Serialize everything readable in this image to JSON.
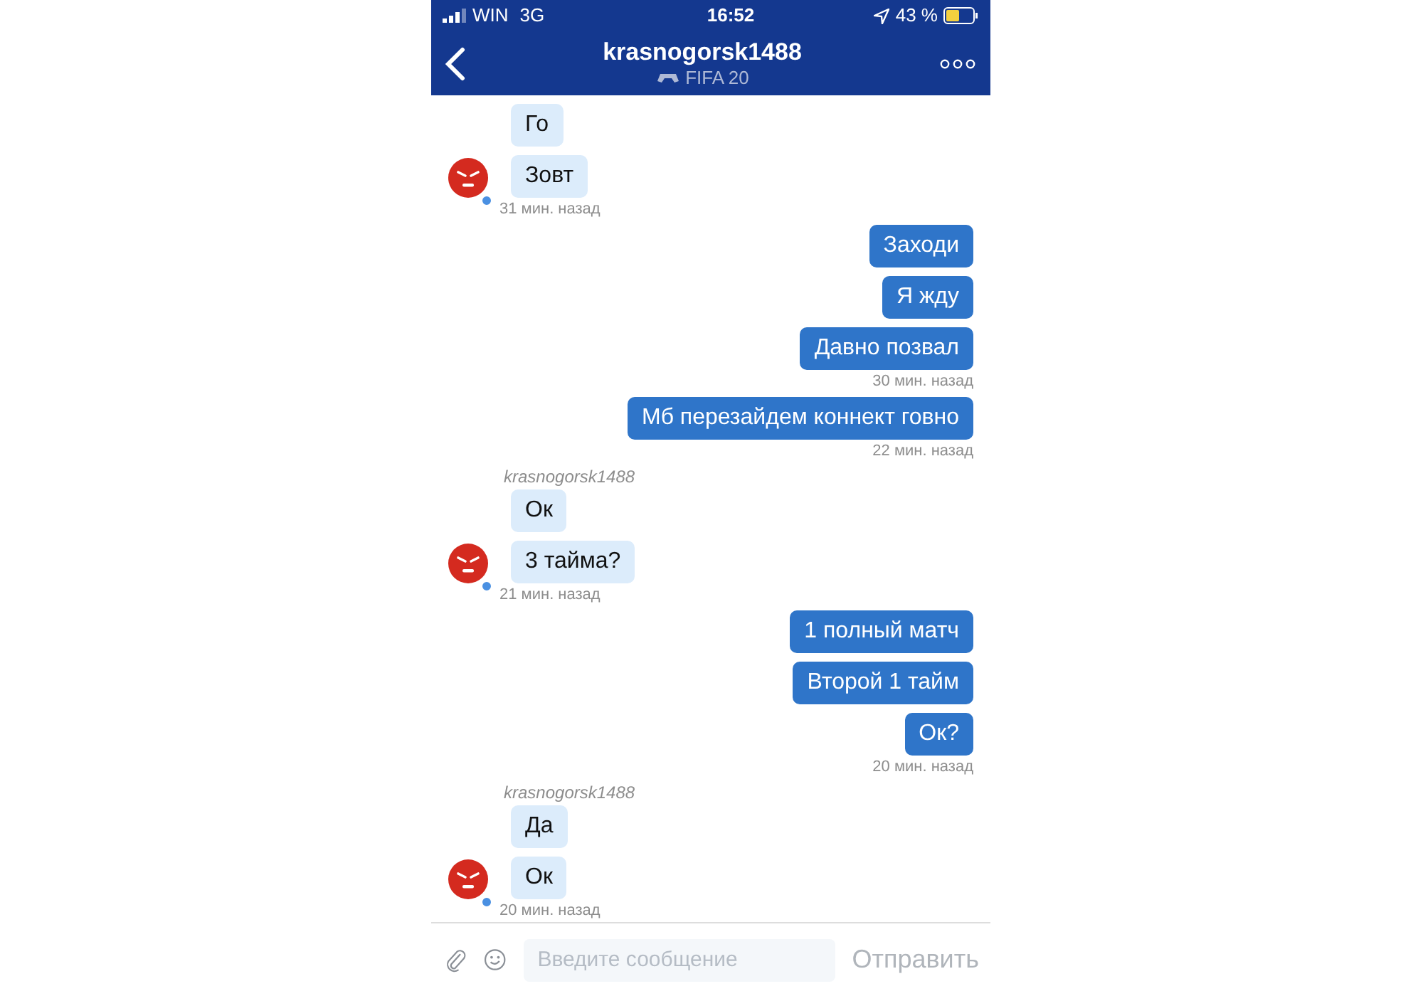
{
  "status_bar": {
    "carrier": "WIN",
    "network": "3G",
    "time": "16:52",
    "battery": "43 %"
  },
  "header": {
    "title": "krasnogorsk1488",
    "subtitle": "FIFA 20"
  },
  "messages": [
    {
      "kind": "incoming",
      "online": true,
      "bubbles": [
        "Го",
        "Зовт"
      ],
      "time": "31 мин. назад"
    },
    {
      "kind": "outgoing",
      "bubbles": [
        "Заходи",
        "Я жду",
        "Давно позвал"
      ],
      "time": "30 мин. назад"
    },
    {
      "kind": "outgoing",
      "bubbles": [
        "Мб перезайдем коннект говно"
      ],
      "time": "22 мин. назад"
    },
    {
      "kind": "incoming",
      "online": true,
      "author": "krasnogorsk1488",
      "bubbles": [
        "Ок",
        "3 тайма?"
      ],
      "time": "21 мин. назад"
    },
    {
      "kind": "outgoing",
      "bubbles": [
        "1 полный матч",
        "Второй 1 тайм",
        "Ок?"
      ],
      "time": "20 мин. назад"
    },
    {
      "kind": "incoming",
      "online": true,
      "author": "krasnogorsk1488",
      "bubbles": [
        "Да",
        "Ок"
      ],
      "time": "20 мин. назад"
    }
  ],
  "composer": {
    "placeholder": "Введите сообщение",
    "send": "Отправить"
  }
}
